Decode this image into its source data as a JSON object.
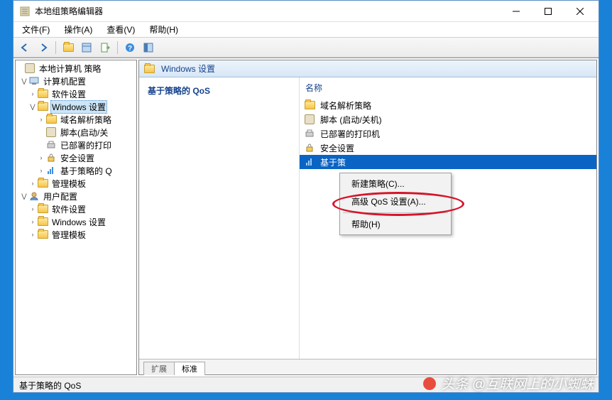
{
  "window": {
    "title": "本地组策略编辑器"
  },
  "menu": {
    "file": "文件(F)",
    "action": "操作(A)",
    "view": "查看(V)",
    "help": "帮助(H)"
  },
  "breadcrumb": {
    "label": "Windows 设置"
  },
  "tree": {
    "root": "本地计算机 策略",
    "computer_config": "计算机配置",
    "software_settings": "软件设置",
    "windows_settings": "Windows 设置",
    "name_resolution": "域名解析策略",
    "scripts": "脚本(启动/关",
    "deployed_printers": "已部署的打印",
    "security_settings": "安全设置",
    "qos": "基于策略的 Q",
    "admin_templates": "管理模板",
    "user_config": "用户配置",
    "u_software": "软件设置",
    "u_windows": "Windows 设置",
    "u_admin": "管理模板"
  },
  "desc": {
    "heading": "基于策略的 QoS"
  },
  "columns": {
    "name": "名称"
  },
  "items": {
    "name_resolution": "域名解析策略",
    "scripts": "脚本 (启动/关机)",
    "printers": "已部署的打印机",
    "security": "安全设置",
    "qos": "基于策",
    "qos_full": "基于策略的 QoS"
  },
  "tabs": {
    "extended": "扩展",
    "standard": "标准"
  },
  "context": {
    "new_policy": "新建策略(C)...",
    "advanced": "高级 QoS 设置(A)...",
    "help": "帮助(H)"
  },
  "status": {
    "text": "基于策略的 QoS"
  },
  "watermark": {
    "text": "头条 @互联网上的小蜘蛛"
  }
}
